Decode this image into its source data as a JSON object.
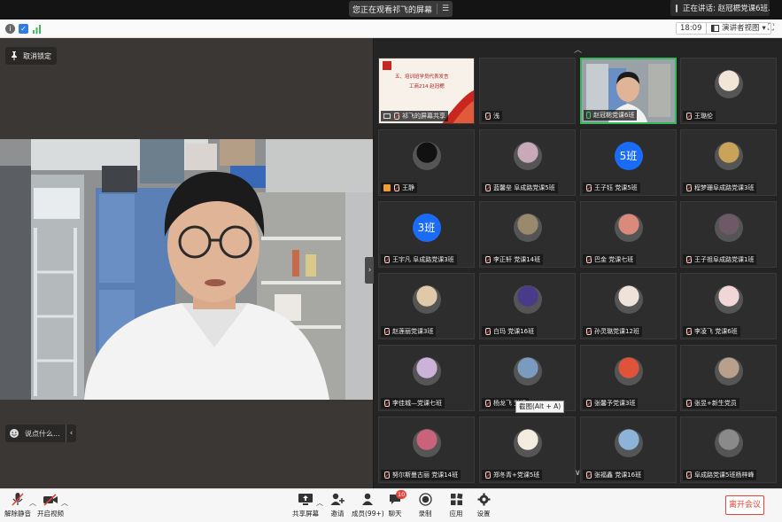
{
  "top": {
    "share_status": "您正在观看祁飞的屏幕",
    "menu_glyph": "☰",
    "speaking_label": "正在讲话: 赵冠楒党课6班..."
  },
  "infobar": {
    "time": "18:09",
    "view_label": "演讲者视图",
    "view_caret": "▾",
    "fullscreen_glyph": "⛶"
  },
  "stage": {
    "unpin_label": "取消锁定",
    "collapse_glyph": "›",
    "chat_placeholder": "说点什么...",
    "chat_chevron": "‹"
  },
  "gallery": {
    "up_chevron": "︿",
    "down_chevron": "∨",
    "tooltip": "截图(Alt + A)",
    "slide_title": "五、培训班学员代表发言",
    "slide_subtitle": "工商214  赵冠楒",
    "tiles": [
      {
        "label": "祁飞的屏幕共享",
        "kind": "slide"
      },
      {
        "label": "浅",
        "kind": "empty"
      },
      {
        "label": "赵冠楒党课6班",
        "kind": "camera",
        "mic": "on"
      },
      {
        "label": "王璐伦",
        "kind": "avatar",
        "color": "#f2e6d9"
      },
      {
        "label": "王静",
        "kind": "avatar",
        "color": "#111111"
      },
      {
        "label": "蓝馨垒 阜成路党课5班",
        "kind": "avatar",
        "color": "#c9a8b8"
      },
      {
        "label": "王子钰 党课5班",
        "kind": "badge",
        "badge": "5班"
      },
      {
        "label": "程梦珊阜成路党课3班",
        "kind": "avatar",
        "color": "#caa35b"
      },
      {
        "label": "王宇凡 阜成路党课3班",
        "kind": "badge",
        "badge": "3班"
      },
      {
        "label": "李正轩 党课14班",
        "kind": "avatar",
        "color": "#9a8a6d"
      },
      {
        "label": "巴金  党课七班",
        "kind": "avatar",
        "color": "#d98a7a"
      },
      {
        "label": "王子祖阜成路党课1班",
        "kind": "avatar",
        "color": "#6d5a66"
      },
      {
        "label": "赵莲丽党课3班",
        "kind": "avatar",
        "color": "#e0c9a8"
      },
      {
        "label": "白玛 党课16班",
        "kind": "avatar",
        "color": "#4a3a8a"
      },
      {
        "label": "孙灵璐党课12班",
        "kind": "avatar",
        "color": "#efe2d8"
      },
      {
        "label": "李凌飞 党课6班",
        "kind": "avatar",
        "color": "#f0d6d6"
      },
      {
        "label": "李佳城—党课七班",
        "kind": "avatar",
        "color": "#cbb2d9"
      },
      {
        "label": "杨龙飞 党课",
        "kind": "avatar",
        "color": "#7a9abf"
      },
      {
        "label": "张馨予党课3班",
        "kind": "avatar",
        "color": "#e0533b"
      },
      {
        "label": "张昱+新生党员",
        "kind": "avatar",
        "color": "#b9a08c"
      },
      {
        "label": "努尔斯曼古丽  党课14班",
        "kind": "avatar",
        "color": "#c9627a"
      },
      {
        "label": "郑冬青+党课5班",
        "kind": "avatar",
        "color": "#f3ece0"
      },
      {
        "label": "张福鑫 党课16班",
        "kind": "avatar",
        "color": "#8eb3d9"
      },
      {
        "label": "阜成路党课5班杨梓峰",
        "kind": "avatar",
        "color": "#8a8a8a"
      }
    ]
  },
  "toolbar": {
    "unmute": "解除静音",
    "start_video": "开启视频",
    "share_screen": "共享屏幕",
    "invite": "邀请",
    "members": "成员(99+)",
    "chat": "聊天",
    "chat_badge": "10",
    "record": "录制",
    "apps": "应用",
    "settings": "设置",
    "leave": "离开会议",
    "caret": "︿"
  },
  "colors": {
    "accent_green": "#38b85c",
    "leave_red": "#e0453a",
    "badge_blue": "#1a6bf5"
  }
}
